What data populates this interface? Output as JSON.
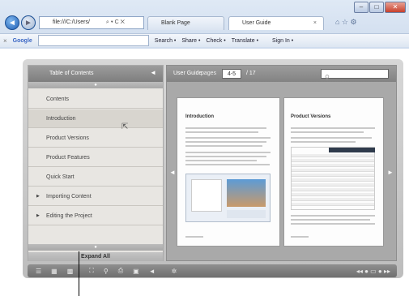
{
  "browser": {
    "address": "file:///C:/Users/",
    "address_icons": "⌕ ▾ C ✕",
    "tabs": [
      {
        "label": "Blank Page"
      },
      {
        "label": "User Guide",
        "active": true
      }
    ],
    "close_x": "×",
    "search_provider": "Google",
    "toolbar": [
      "Search •",
      "Share •",
      "Check •",
      "Translate •",
      "Sign In •"
    ]
  },
  "sidebar": {
    "title": "Table of Contents",
    "collapse": "◄",
    "items": [
      {
        "label": "Contents"
      },
      {
        "label": "Introduction"
      },
      {
        "label": "Product Versions"
      },
      {
        "label": "Product Features"
      },
      {
        "label": "Quick Start"
      },
      {
        "label": "Importing Content"
      },
      {
        "label": "Editing the Project"
      }
    ],
    "expand_label": "Expand All"
  },
  "reader": {
    "title": "User Guide",
    "pages_label": "pages",
    "page_value": "4-5",
    "page_total": "/ 17",
    "search_icon": "search-icon",
    "left_page": {
      "heading": "Introduction"
    },
    "right_page": {
      "heading": "Product Versions"
    }
  },
  "bottom_bar": {
    "icons": [
      "list-icon",
      "grid-icon",
      "zoom-icon",
      "print-icon",
      "save-icon",
      "sound-icon",
      "settings-icon",
      "nav-icon"
    ]
  }
}
